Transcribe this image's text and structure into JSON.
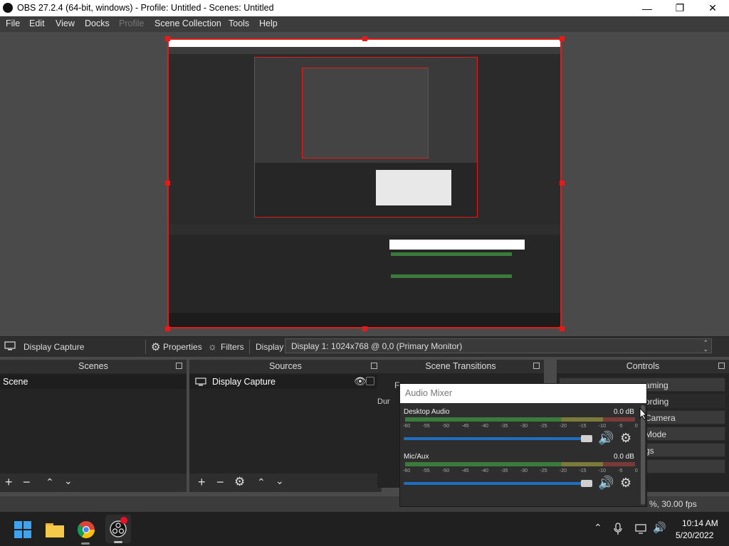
{
  "window": {
    "title": "OBS 27.2.4 (64-bit, windows) - Profile: Untitled - Scenes: Untitled"
  },
  "menu": [
    "File",
    "Edit",
    "View",
    "Docks",
    "Profile",
    "Scene Collection",
    "Tools",
    "Help"
  ],
  "source_toolbar": {
    "source_name": "Display Capture",
    "properties": "Properties",
    "filters": "Filters",
    "display_label": "Display",
    "display_value": "Display 1: 1024x768 @ 0,0 (Primary Monitor)"
  },
  "docks": {
    "scenes": {
      "title": "Scenes",
      "items": [
        "Scene"
      ]
    },
    "sources": {
      "title": "Sources",
      "items": [
        "Display Capture"
      ]
    },
    "transitions": {
      "title": "Scene Transitions",
      "partial": "F",
      "duration_partial": "Dur"
    },
    "controls": {
      "title": "Controls",
      "buttons": [
        "aming",
        "ording",
        "Camera",
        "Mode",
        "gs"
      ]
    }
  },
  "mixer": {
    "title": "Audio Mixer",
    "channels": [
      {
        "name": "Desktop Audio",
        "db": "0.0 dB",
        "volume": 1.0
      },
      {
        "name": "Mic/Aux",
        "db": "0.0 dB",
        "volume": 1.0
      }
    ],
    "ticks": [
      "-60",
      "-55",
      "-50",
      "-45",
      "-40",
      "-35",
      "-30",
      "-25",
      "-20",
      "-15",
      "-10",
      "-5",
      "0"
    ]
  },
  "status": {
    "fps": "%, 30.00 fps"
  },
  "taskbar": {
    "time": "10:14 AM",
    "date": "5/20/2022"
  },
  "colors": {
    "accent": "#1e6fbf",
    "selection": "#e21b1b"
  }
}
